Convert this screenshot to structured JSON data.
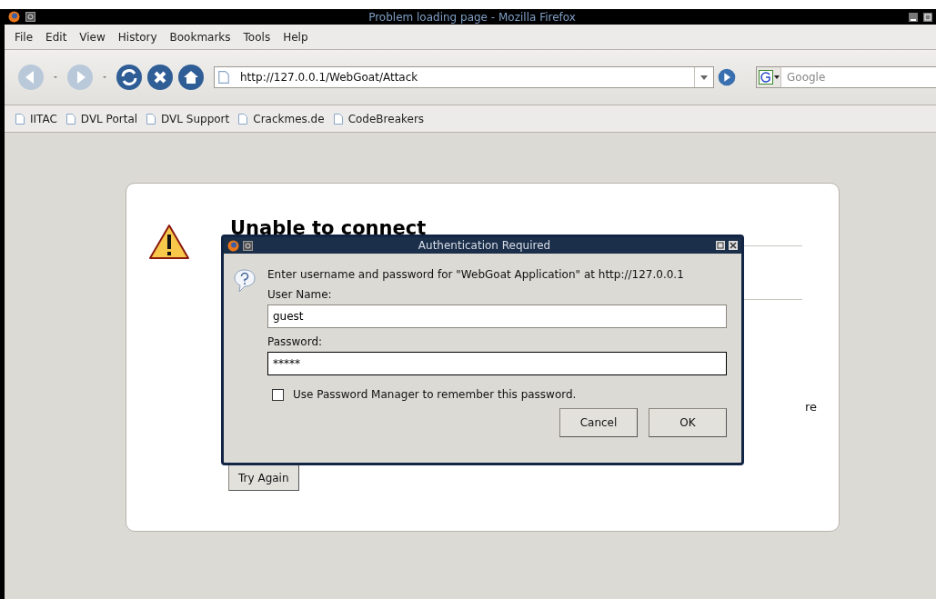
{
  "window": {
    "title": "Problem loading page - Mozilla Firefox"
  },
  "menu": [
    "File",
    "Edit",
    "View",
    "History",
    "Bookmarks",
    "Tools",
    "Help"
  ],
  "toolbar": {
    "back_disabled": true,
    "forward_disabled": true,
    "url": "http://127.0.0.1/WebGoat/Attack",
    "search_placeholder": "Google"
  },
  "bookmarks": [
    "IITAC",
    "DVL Portal",
    "DVL Support",
    "Crackmes.de",
    "CodeBreakers"
  ],
  "error_page": {
    "heading": "Unable to connect",
    "fragment": "re",
    "button": "Try Again"
  },
  "dialog": {
    "title": "Authentication Required",
    "message": "Enter username and password for \"WebGoat Application\" at http://127.0.0.1",
    "fields": [
      {
        "label": "User Name:",
        "value": "guest",
        "focused": false
      },
      {
        "label": "Password:",
        "value": "*****",
        "focused": true
      }
    ],
    "checkbox": {
      "label": "Use Password Manager to remember this password.",
      "checked": false
    },
    "buttons": [
      "Cancel",
      "OK"
    ]
  }
}
